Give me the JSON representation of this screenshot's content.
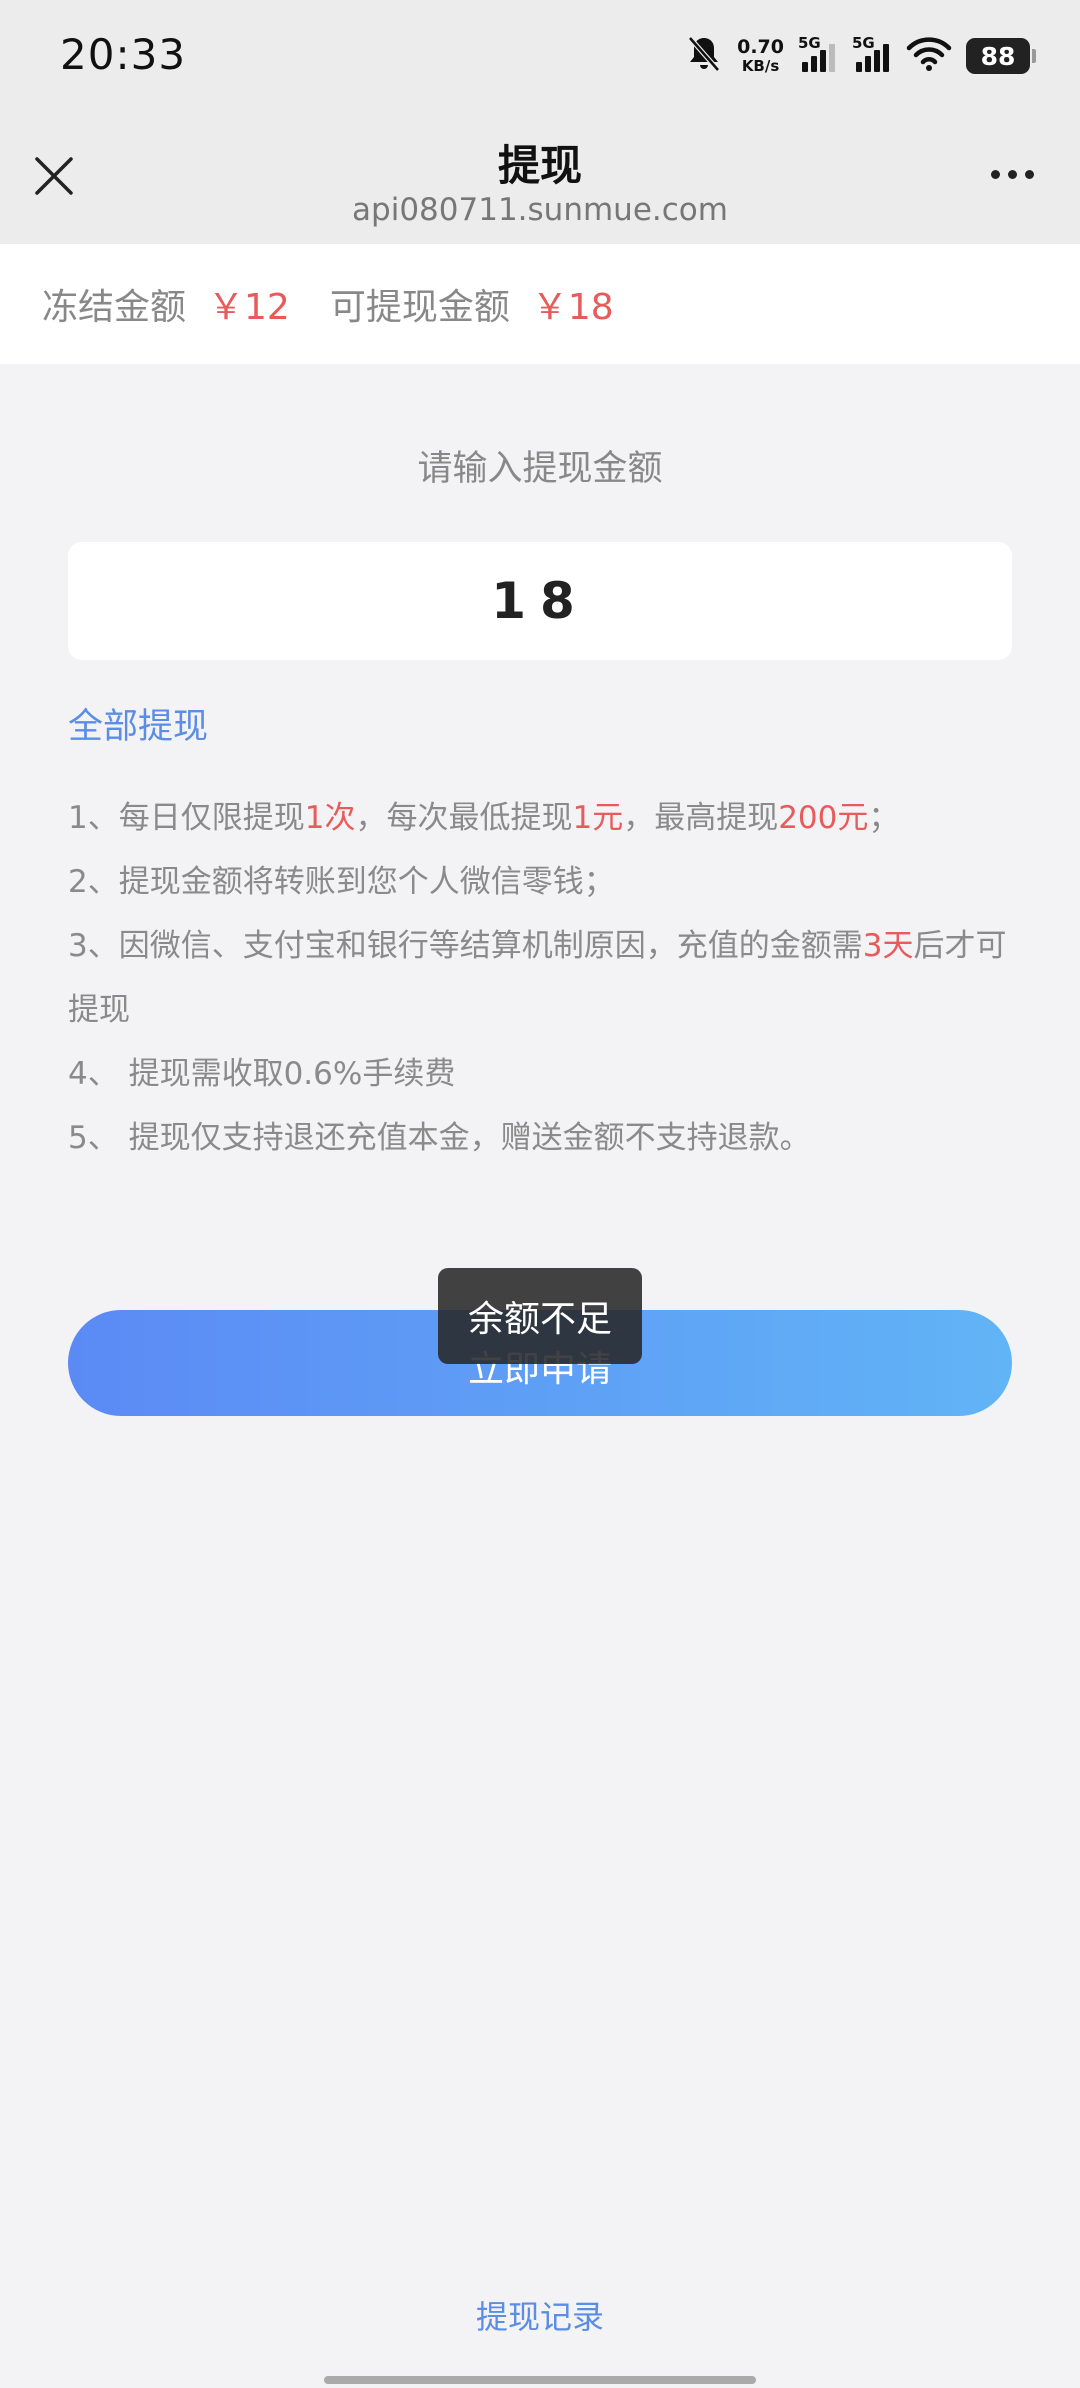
{
  "status_bar": {
    "time": "20:33",
    "net_speed_value": "0.70",
    "net_speed_unit": "KB/s",
    "signal_1_label": "5G",
    "signal_2_label": "5G",
    "battery": "88",
    "icons": [
      "bell-muted-icon",
      "signal-icon",
      "signal-icon",
      "wifi-icon",
      "battery-icon"
    ]
  },
  "nav": {
    "title": "提现",
    "url": "api080711.sunmue.com",
    "close_icon": "close-icon",
    "more_icon": "more-icon"
  },
  "balance": {
    "frozen_label": "冻结金额",
    "frozen_amount": "￥12",
    "available_label": "可提现金额",
    "available_amount": "￥18"
  },
  "form": {
    "prompt": "请输入提现金额",
    "amount_value": "18",
    "withdraw_all_label": "全部提现"
  },
  "rules": {
    "r1_a": "1、每日仅限提现",
    "r1_b": "1次",
    "r1_c": "，每次最低提现",
    "r1_d": "1元",
    "r1_e": "，最高提现",
    "r1_f": "200元",
    "r1_g": "；",
    "r2": "2、提现金额将转账到您个人微信零钱；",
    "r3_a": "3、因微信、支付宝和银行等结算机制原因，充值的金额需",
    "r3_b": "3天",
    "r3_c": "后才可提现",
    "r4": "4、 提现需收取0.6%手续费",
    "r5": "5、 提现仅支持退还充值本金，赠送金额不支持退款。"
  },
  "apply_button_label": "立即申请",
  "toast_text": "余额不足",
  "records_link": "提现记录",
  "colors": {
    "accent_red": "#e85b5b",
    "link_blue": "#5b8de6",
    "button_gradient_start": "#5b8af5",
    "button_gradient_end": "#61b4f6"
  }
}
